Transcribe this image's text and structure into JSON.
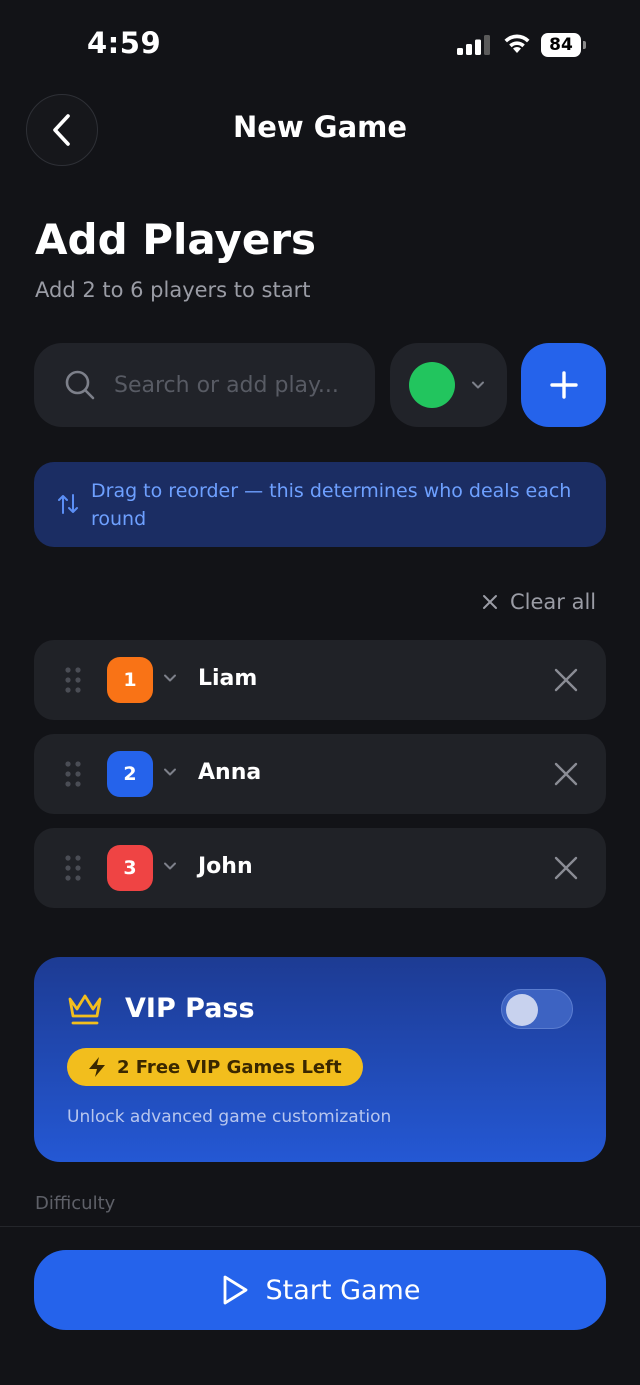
{
  "status_bar": {
    "time": "4:59",
    "battery": "84"
  },
  "header": {
    "title": "New Game"
  },
  "page": {
    "title": "Add Players",
    "subtitle": "Add 2 to 6 players to start"
  },
  "add_player": {
    "placeholder": "Search or add play...",
    "selected_color": "#22c55e"
  },
  "info_banner": {
    "text": "Drag to reorder — this determines who deals each round"
  },
  "clear_all_label": "Clear all",
  "players": [
    {
      "number": "1",
      "name": "Liam",
      "color": "#f97316"
    },
    {
      "number": "2",
      "name": "Anna",
      "color": "#2563eb"
    },
    {
      "number": "3",
      "name": "John",
      "color": "#ef4444"
    }
  ],
  "vip": {
    "title": "VIP Pass",
    "badge": "2 Free VIP Games Left",
    "description": "Unlock advanced game customization",
    "enabled": false
  },
  "difficulty_label": "Difficulty",
  "start_button_label": "Start Game",
  "colors": {
    "accent": "#2563eb",
    "background": "#121317",
    "card": "#202227",
    "vip_gold": "#f2be1d"
  },
  "icons": [
    "search-icon",
    "chevron-down-icon",
    "plus-icon",
    "swap-vertical-icon",
    "close-icon",
    "drag-handle-icon",
    "crown-icon",
    "lightning-icon",
    "play-icon",
    "back-arrow-icon"
  ]
}
